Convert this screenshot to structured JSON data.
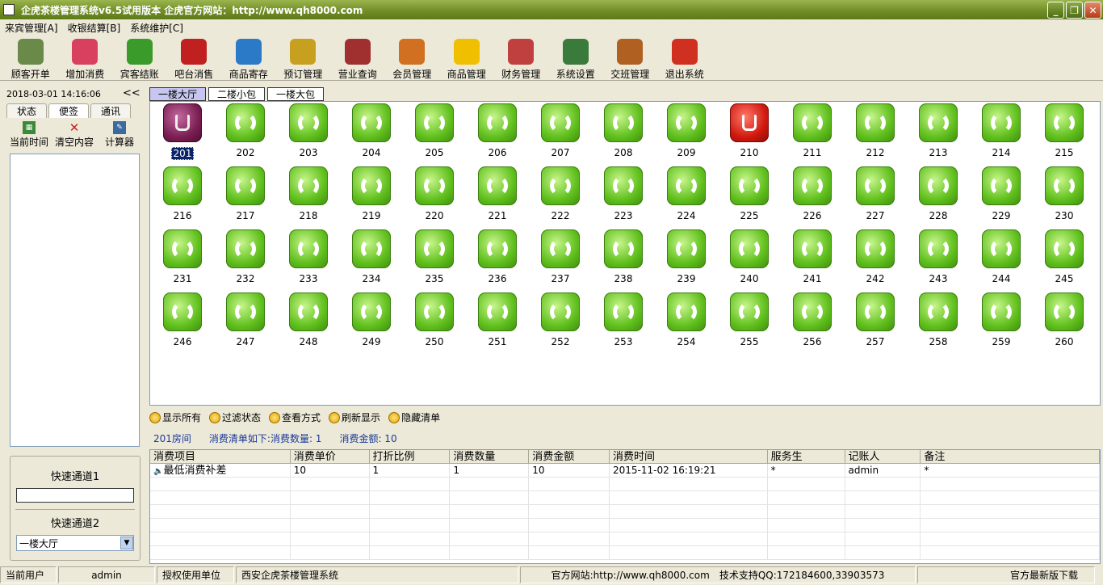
{
  "window": {
    "title": "企虎茶楼管理系统v6.5试用版本 企虎官方网站：http://www.qh8000.com"
  },
  "menu": [
    "来宾管理[A]",
    "收银结算[B]",
    "系统维护[C]"
  ],
  "toolbar": [
    {
      "label": "顾客开单",
      "icon": "teacup-icon",
      "color": "#6a8a4a"
    },
    {
      "label": "增加消费",
      "icon": "plus-heart-icon",
      "color": "#d94060"
    },
    {
      "label": "宾客结账",
      "icon": "money-arrow-icon",
      "color": "#3a9a2a"
    },
    {
      "label": "吧台消售",
      "icon": "bar-counter-icon",
      "color": "#c02020"
    },
    {
      "label": "商品寄存",
      "icon": "basket-icon",
      "color": "#2a7ac8"
    },
    {
      "label": "预订管理",
      "icon": "clock-icon",
      "color": "#c8a020"
    },
    {
      "label": "营业查询",
      "icon": "book-search-icon",
      "color": "#a03030"
    },
    {
      "label": "会员管理",
      "icon": "members-icon",
      "color": "#d07020"
    },
    {
      "label": "商品管理",
      "icon": "star-icon",
      "color": "#f0c000"
    },
    {
      "label": "财务管理",
      "icon": "finance-icon",
      "color": "#c04040"
    },
    {
      "label": "系统设置",
      "icon": "settings-doc-icon",
      "color": "#3a7a3a"
    },
    {
      "label": "交班管理",
      "icon": "exit-door-icon",
      "color": "#b06020"
    },
    {
      "label": "退出系统",
      "icon": "power-icon",
      "color": "#d03020"
    }
  ],
  "left": {
    "datetime": "2018-03-01 14:16:06",
    "collapse": "<<",
    "tabs": [
      "状态",
      "便签",
      "通讯"
    ],
    "tools": [
      {
        "label": "当前时间",
        "icon": "calendar-icon"
      },
      {
        "label": "清空内容",
        "icon": "clear-x-icon"
      },
      {
        "label": "计算器",
        "icon": "calculator-icon"
      }
    ],
    "quick1_label": "快速通道1",
    "quick2_label": "快速通道2",
    "quick2_value": "一楼大厅"
  },
  "room_tabs": [
    "一楼大厅",
    "二楼小包",
    "一楼大包"
  ],
  "rooms": {
    "selected": "201",
    "occupied": [
      "210"
    ],
    "numbers": [
      "201",
      "202",
      "203",
      "204",
      "205",
      "206",
      "207",
      "208",
      "209",
      "210",
      "211",
      "212",
      "213",
      "214",
      "215",
      "216",
      "217",
      "218",
      "219",
      "220",
      "221",
      "222",
      "223",
      "224",
      "225",
      "226",
      "227",
      "228",
      "229",
      "230",
      "231",
      "232",
      "233",
      "234",
      "235",
      "236",
      "237",
      "238",
      "239",
      "240",
      "241",
      "242",
      "243",
      "244",
      "245",
      "246",
      "247",
      "248",
      "249",
      "250",
      "251",
      "252",
      "253",
      "254",
      "255",
      "256",
      "257",
      "258",
      "259",
      "260"
    ]
  },
  "actions": [
    "显示所有",
    "过滤状态",
    "查看方式",
    "刷新显示",
    "隐藏清单"
  ],
  "info": {
    "room": "201房间",
    "summary": "消费清单如下:消费数量: 1",
    "amount": "消费金额: 10"
  },
  "table": {
    "columns": [
      "消费项目",
      "消费单价",
      "打折比例",
      "消费数量",
      "消费金额",
      "消费时间",
      "服务生",
      "记账人",
      "备注"
    ],
    "rows": [
      [
        "最低消费补差",
        "10",
        "1",
        "1",
        "10",
        "2015-11-02 16:19:21",
        "*",
        "admin",
        "*"
      ]
    ]
  },
  "status": {
    "user_label": "当前用户",
    "user": "admin",
    "auth_label": "授权使用单位",
    "company": "西安企虎茶楼管理系统",
    "website": "官方网站:http://www.qh8000.com",
    "support": "技术支持QQ:172184600,33903573",
    "download": "官方最新版下载"
  }
}
